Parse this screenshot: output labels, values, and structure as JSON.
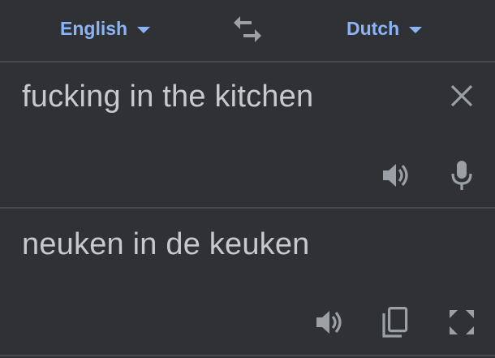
{
  "languages": {
    "source": "English",
    "target": "Dutch"
  },
  "input": {
    "text": "fucking in the kitchen"
  },
  "output": {
    "text": "neuken in de keuken"
  },
  "icons": {
    "swap": "swap-languages-icon",
    "clear": "close-icon",
    "listen_source": "speaker-icon",
    "mic": "microphone-icon",
    "listen_target": "speaker-icon",
    "copy": "copy-icon",
    "fullscreen": "fullscreen-icon"
  },
  "colors": {
    "background": "#303134",
    "accent": "#8ab4f8",
    "text": "#c8c9cc",
    "icon": "#9aa0a6",
    "divider": "#48494d"
  }
}
